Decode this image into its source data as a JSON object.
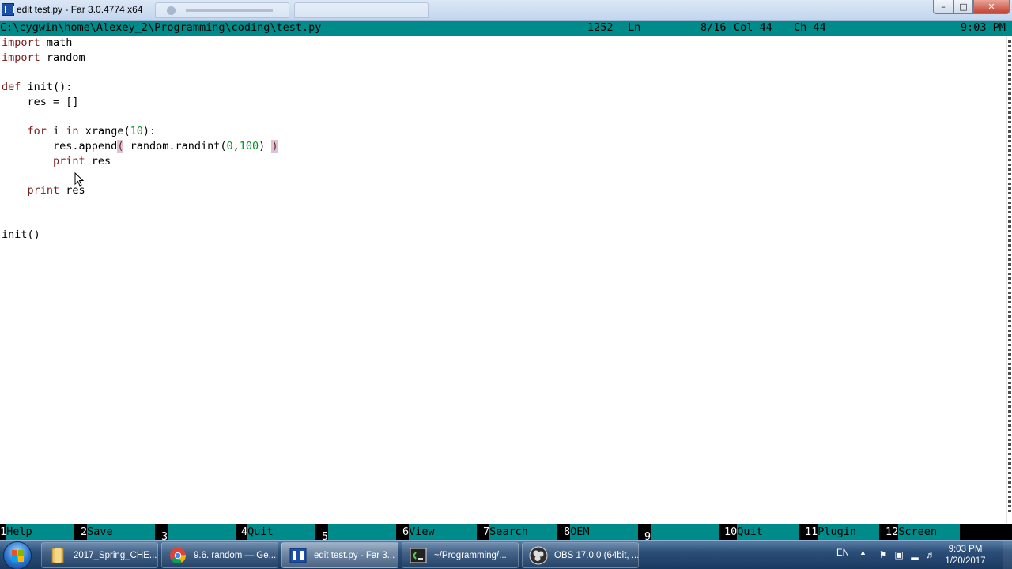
{
  "window": {
    "title": "edit test.py - Far 3.0.4774 x64",
    "minimize_glyph": "–",
    "maximize_glyph": "□",
    "close_glyph": "✕"
  },
  "status_bar": {
    "path": "C:\\cygwin\\home\\Alexey_2\\Programming\\coding\\test.py",
    "codepage": "1252",
    "ln_label": "Ln",
    "line_pos": "8/16",
    "col": "Col 44",
    "ch": "Ch 44",
    "time": "9:03 PM"
  },
  "editor": {
    "lines": [
      {
        "indent": "",
        "parts": [
          {
            "t": "import",
            "c": "kw"
          },
          {
            "t": " math",
            "c": ""
          }
        ]
      },
      {
        "indent": "",
        "parts": [
          {
            "t": "import",
            "c": "kw"
          },
          {
            "t": " random",
            "c": ""
          }
        ]
      },
      {
        "indent": "",
        "parts": []
      },
      {
        "indent": "",
        "parts": [
          {
            "t": "def",
            "c": "kw"
          },
          {
            "t": " init():",
            "c": ""
          }
        ]
      },
      {
        "indent": "    ",
        "parts": [
          {
            "t": "res = []",
            "c": ""
          }
        ]
      },
      {
        "indent": "",
        "parts": []
      },
      {
        "indent": "    ",
        "parts": [
          {
            "t": "for",
            "c": "kw"
          },
          {
            "t": " i ",
            "c": ""
          },
          {
            "t": "in",
            "c": "kw"
          },
          {
            "t": " xrange(",
            "c": ""
          },
          {
            "t": "10",
            "c": "num"
          },
          {
            "t": "):",
            "c": ""
          }
        ]
      },
      {
        "indent": "        ",
        "parts": [
          {
            "t": "res.append",
            "c": ""
          },
          {
            "t": "(",
            "c": "paren-hl"
          },
          {
            "t": " random.randint(",
            "c": ""
          },
          {
            "t": "0",
            "c": "num"
          },
          {
            "t": ",",
            "c": ""
          },
          {
            "t": "100",
            "c": "num"
          },
          {
            "t": ") ",
            "c": ""
          },
          {
            "t": ")",
            "c": "paren-hl"
          }
        ]
      },
      {
        "indent": "        ",
        "parts": [
          {
            "t": "print",
            "c": "kw"
          },
          {
            "t": " res",
            "c": ""
          }
        ]
      },
      {
        "indent": "",
        "parts": []
      },
      {
        "indent": "    ",
        "parts": [
          {
            "t": "print",
            "c": "kw"
          },
          {
            "t": " res",
            "c": ""
          }
        ]
      },
      {
        "indent": "",
        "parts": []
      },
      {
        "indent": "",
        "parts": []
      },
      {
        "indent": "",
        "parts": [
          {
            "t": "init()",
            "c": ""
          }
        ]
      }
    ]
  },
  "keybar": [
    {
      "num": "1",
      "label": "Help"
    },
    {
      "num": "2",
      "label": "Save"
    },
    {
      "num": "3",
      "label": ""
    },
    {
      "num": "4",
      "label": "Quit"
    },
    {
      "num": "5",
      "label": ""
    },
    {
      "num": "6",
      "label": "View"
    },
    {
      "num": "7",
      "label": "Search"
    },
    {
      "num": "8",
      "label": "OEM"
    },
    {
      "num": "9",
      "label": ""
    },
    {
      "num": "10",
      "label": "Quit"
    },
    {
      "num": "11",
      "label": "Plugin"
    },
    {
      "num": "12",
      "label": "Screen"
    }
  ],
  "taskbar": {
    "tasks": [
      {
        "label": "2017_Spring_CHE...",
        "icon": "folder-icon"
      },
      {
        "label": "9.6. random — Ge...",
        "icon": "chrome-icon"
      },
      {
        "label": "edit test.py - Far 3...",
        "icon": "far-manager-icon",
        "active": true
      },
      {
        "label": "~/Programming/...",
        "icon": "terminal-icon"
      },
      {
        "label": "OBS 17.0.0 (64bit, ...",
        "icon": "obs-icon"
      }
    ],
    "tray": {
      "language": "EN",
      "time": "9:03 PM",
      "date": "1/20/2017"
    }
  },
  "colors": {
    "far_cyan": "#008b8b",
    "keyword": "#7a1a1a",
    "number": "#0a8f2a",
    "bracket_highlight": "#d8c6d6"
  }
}
